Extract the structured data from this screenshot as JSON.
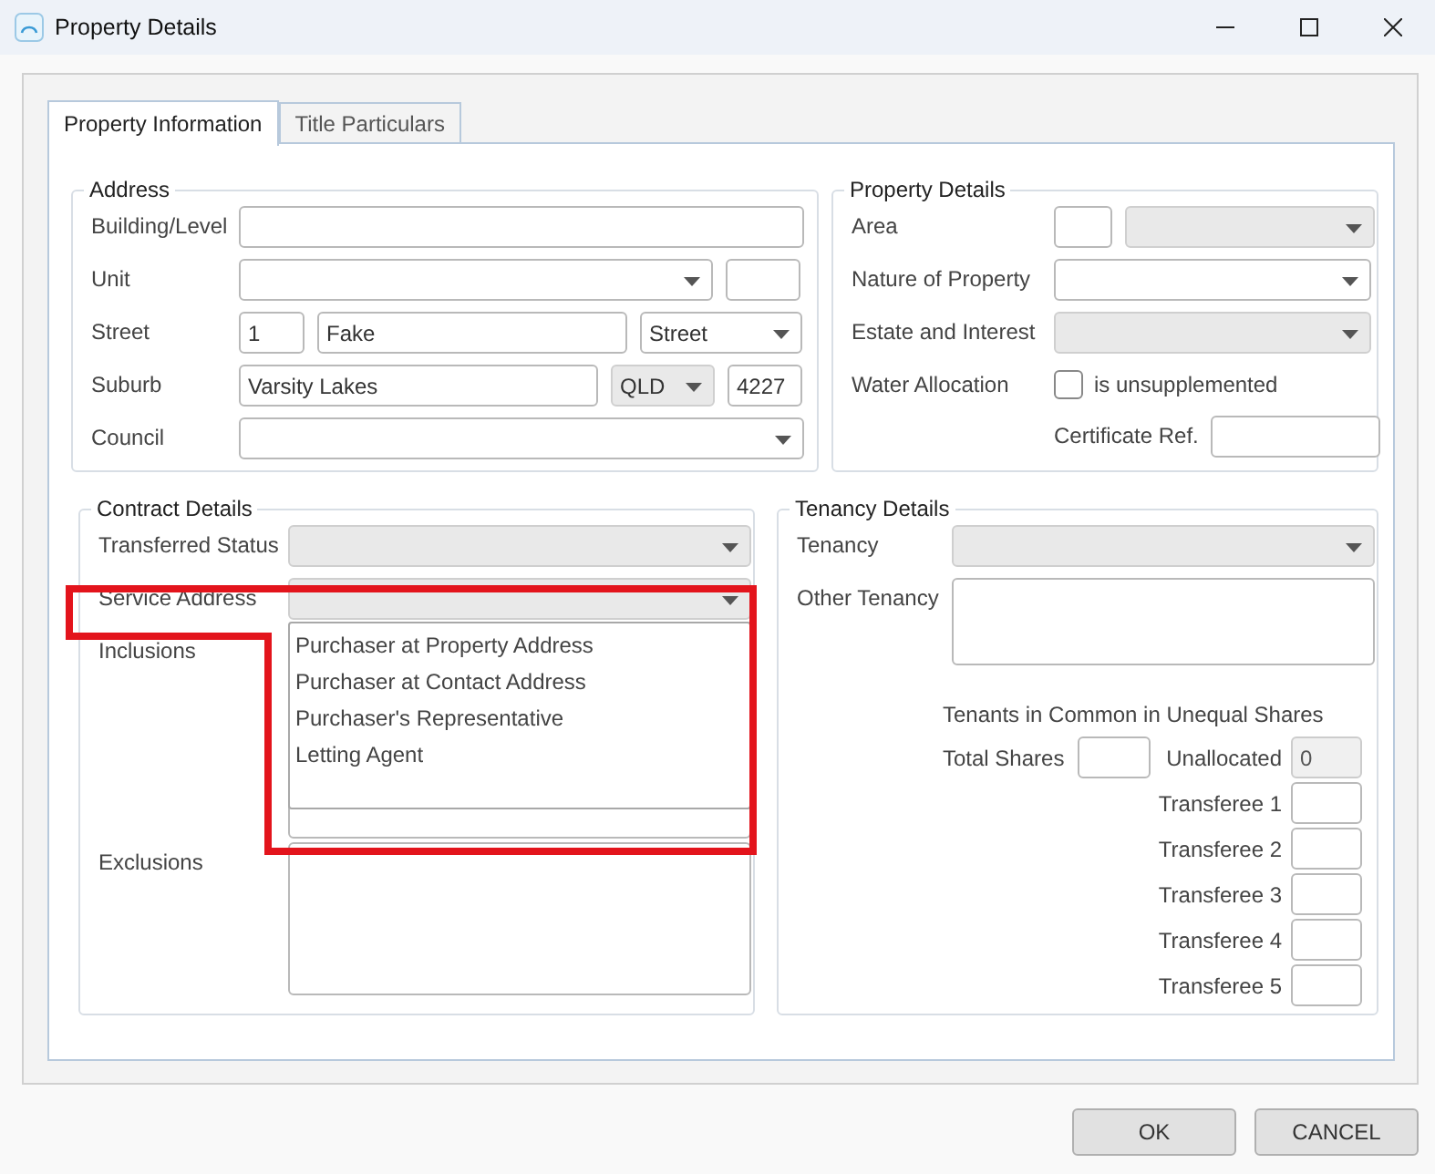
{
  "window": {
    "title": "Property Details"
  },
  "tabs": [
    {
      "label": "Property Information",
      "selected": true
    },
    {
      "label": "Title Particulars",
      "selected": false
    }
  ],
  "address": {
    "title": "Address",
    "rows": [
      {
        "label": "Building/Level",
        "fields": [
          {
            "kind": "text"
          }
        ]
      },
      {
        "label": "Unit",
        "fields": [
          {
            "kind": "combo",
            "disabled": false
          },
          {
            "kind": "text"
          }
        ]
      },
      {
        "label": "Street",
        "fields": [
          {
            "kind": "text",
            "value": "1"
          },
          {
            "kind": "text",
            "value": "Fake"
          },
          {
            "kind": "combo",
            "disabled": false,
            "value": "Street"
          }
        ]
      },
      {
        "label": "Suburb",
        "fields": [
          {
            "kind": "text",
            "value": "Varsity Lakes"
          },
          {
            "kind": "combo",
            "disabled": true,
            "value": "QLD"
          },
          {
            "kind": "text",
            "value": "4227"
          }
        ]
      },
      {
        "label": "Council",
        "fields": [
          {
            "kind": "combo",
            "disabled": false
          }
        ]
      }
    ]
  },
  "property_details": {
    "title": "Property Details",
    "rows": [
      {
        "label": "Area",
        "fields": [
          {
            "kind": "text"
          },
          {
            "kind": "combo",
            "disabled": true
          }
        ]
      },
      {
        "label": "Nature of Property",
        "fields": [
          {
            "kind": "combo",
            "disabled": false
          }
        ]
      },
      {
        "label": "Estate and Interest",
        "fields": [
          {
            "kind": "combo",
            "disabled": true
          }
        ]
      },
      {
        "label": "Water Allocation",
        "fields": [
          {
            "kind": "checkbox",
            "text": "is unsupplemented",
            "checked": false
          }
        ]
      },
      {
        "fields": [
          {
            "kind": "caption",
            "text": "Certificate Ref."
          },
          {
            "kind": "text"
          }
        ]
      }
    ]
  },
  "contract_details": {
    "title": "Contract Details",
    "rows": [
      {
        "label": "Transferred Status",
        "fields": [
          {
            "kind": "combo",
            "disabled": true
          }
        ]
      },
      {
        "label": "Service Address",
        "fields": [
          {
            "kind": "combo",
            "disabled": true,
            "expanded": true,
            "options": [
              {
                "label": "Purchaser at Property Address",
                "selected": false
              },
              {
                "label": "Purchaser at Contact Address",
                "selected": false
              },
              {
                "label": "Purchaser's Representative",
                "selected": false
              },
              {
                "label": "Letting Agent",
                "selected": false
              }
            ]
          }
        ]
      },
      {
        "label": "Inclusions",
        "fields": [
          {
            "kind": "textarea"
          }
        ]
      },
      {
        "label": "Exclusions",
        "fields": [
          {
            "kind": "textarea"
          }
        ]
      }
    ]
  },
  "tenancy_details": {
    "title": "Tenancy Details",
    "rows": [
      {
        "label": "Tenancy",
        "fields": [
          {
            "kind": "combo",
            "disabled": true
          }
        ]
      },
      {
        "label": "Other Tenancy",
        "fields": [
          {
            "kind": "textarea"
          }
        ]
      }
    ],
    "shares": {
      "caption": "Tenants in Common in Unequal Shares",
      "total_label": "Total Shares",
      "unallocated": {
        "label": "Unallocated",
        "value": "0",
        "disabled": true
      },
      "transferees": [
        {
          "label": "Transferee 1"
        },
        {
          "label": "Transferee 2"
        },
        {
          "label": "Transferee 3"
        },
        {
          "label": "Transferee 4"
        },
        {
          "label": "Transferee 5"
        }
      ]
    }
  },
  "buttons": [
    {
      "label": "OK"
    },
    {
      "label": "CANCEL"
    }
  ]
}
